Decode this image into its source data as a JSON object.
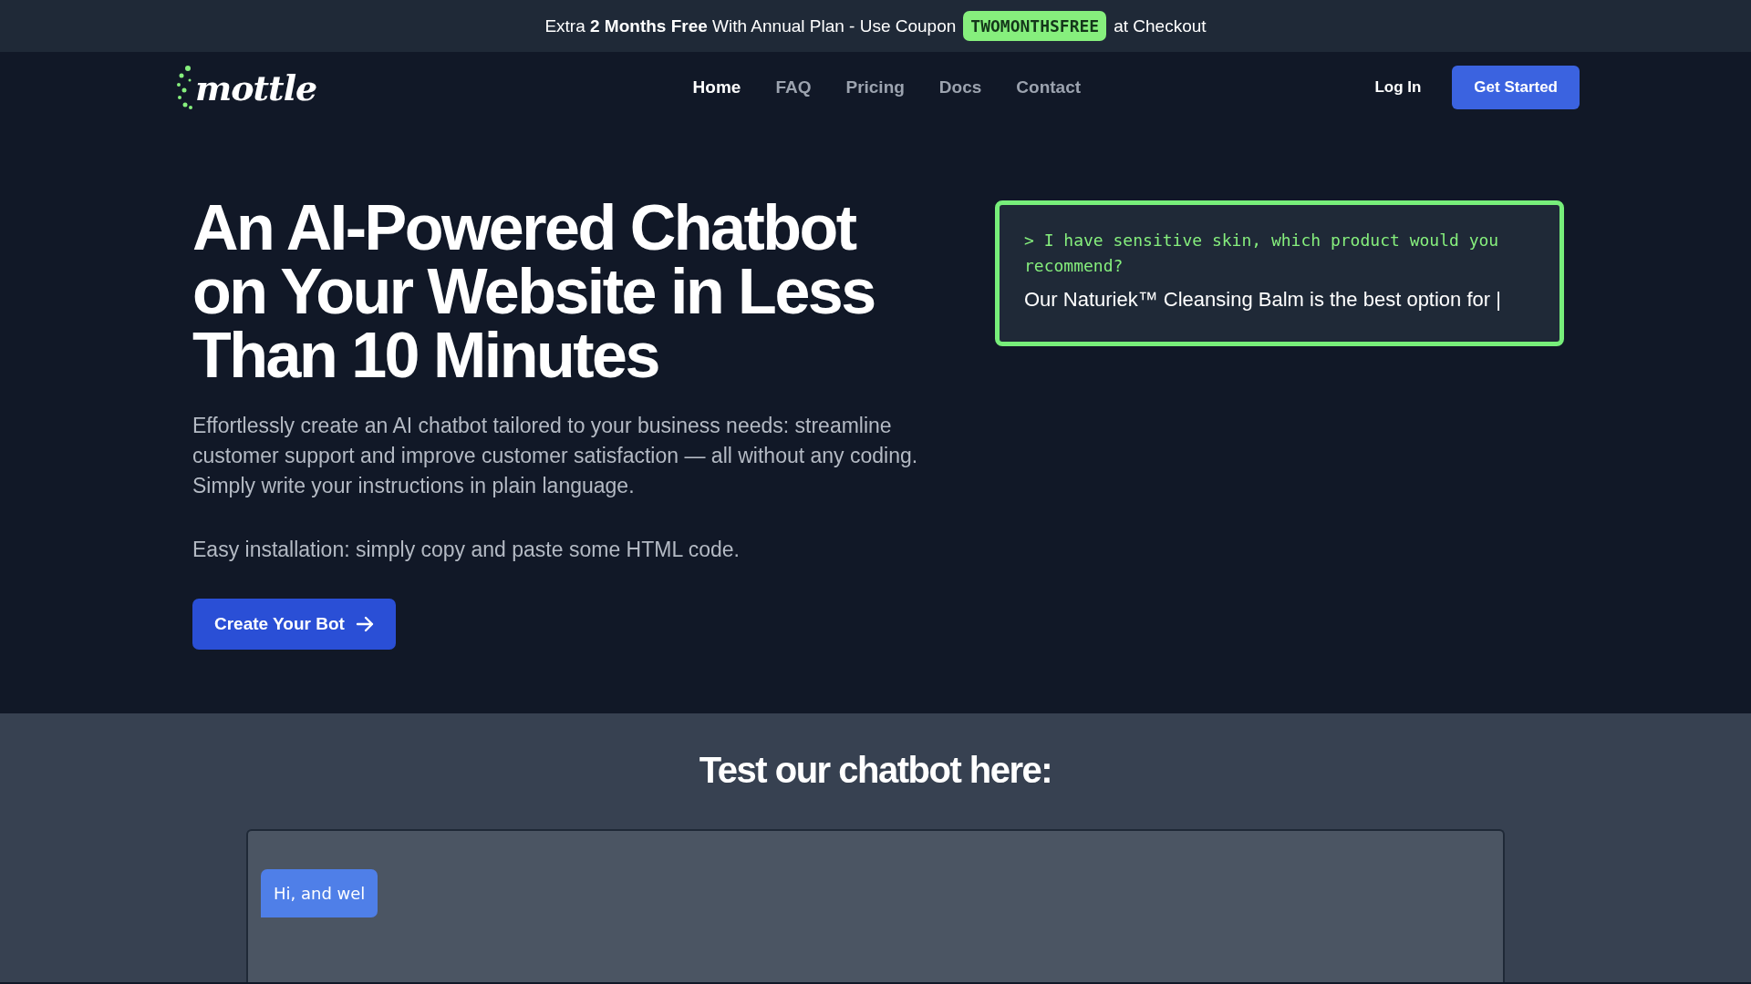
{
  "announcement": {
    "text": "Extra **2 Months Free** With Annual Plan - Use Coupon",
    "coupon": "TWOMONTHSFREE",
    "after": "at Checkout"
  },
  "nav": {
    "logo": "mottle",
    "links": [
      {
        "label": "Home",
        "selected": true
      },
      {
        "label": "FAQ",
        "selected": false
      },
      {
        "label": "Pricing",
        "selected": false
      },
      {
        "label": "Docs",
        "selected": false
      },
      {
        "label": "Contact",
        "selected": false
      }
    ],
    "login": "Log In",
    "cta": "Get Started"
  },
  "hero": {
    "title": "An AI-Powered Chatbot on Your Website in Less Than 10 Minutes",
    "description": "Effortlessly create an AI chatbot tailored to your business needs: streamline customer support and improve customer satisfaction — all without any coding. Simply write your instructions in plain language.",
    "install": "Easy installation: simply copy and paste some HTML code.",
    "button": "Create Your Bot"
  },
  "demo": {
    "prompt": "> I have sensitive skin, which product would you recommend?",
    "answer": "Our Naturiek™ Cleansing Balm is the best option for |"
  },
  "test": {
    "title": "Test our chatbot here:",
    "messages": [
      "Hi, and wel"
    ]
  }
}
